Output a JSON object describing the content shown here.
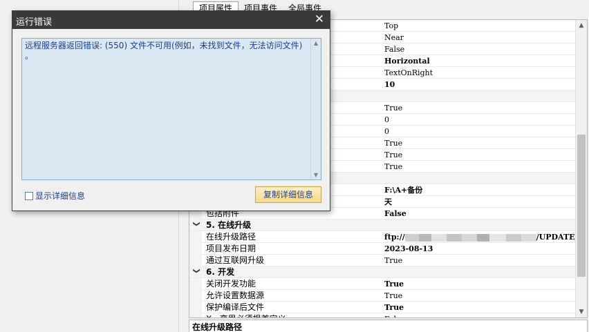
{
  "tabs": [
    "项目属性",
    "项目事件",
    "全局事件"
  ],
  "rows": [
    {
      "type": "prop",
      "name": "",
      "value": "Top",
      "bold": false
    },
    {
      "type": "prop",
      "name": "",
      "value": "Near",
      "bold": false
    },
    {
      "type": "prop",
      "name": "",
      "value": "False",
      "bold": false
    },
    {
      "type": "prop",
      "name": "",
      "value": "Horizontal",
      "bold": true
    },
    {
      "type": "prop",
      "name": "",
      "value": "TextOnRight",
      "bold": false
    },
    {
      "type": "prop",
      "name": "",
      "value": "10",
      "bold": true
    },
    {
      "type": "cat",
      "name": "",
      "value": "",
      "bold": false
    },
    {
      "type": "prop",
      "name": "",
      "value": "True",
      "bold": false
    },
    {
      "type": "prop",
      "name": "",
      "value": "0",
      "bold": false
    },
    {
      "type": "prop",
      "name": "",
      "value": "0",
      "bold": false
    },
    {
      "type": "prop",
      "name": "",
      "value": "True",
      "bold": false
    },
    {
      "type": "prop",
      "name": "",
      "value": "True",
      "bold": false
    },
    {
      "type": "prop",
      "name": "",
      "value": "True",
      "bold": false
    },
    {
      "type": "cat",
      "name": "",
      "value": "",
      "bold": false
    },
    {
      "type": "prop",
      "name": "",
      "value": "F:\\A+备份",
      "bold": true
    },
    {
      "type": "prop",
      "name": "",
      "value": "天",
      "bold": true
    },
    {
      "type": "prop",
      "name": "包括附件",
      "value": "False",
      "bold": true
    },
    {
      "type": "cat",
      "name": "5. 在线升级",
      "value": "",
      "bold": false
    },
    {
      "type": "prop",
      "name": "在线升级路径",
      "value": "ftp://",
      "suffix": "/UPDATE",
      "bold": true,
      "masked": true
    },
    {
      "type": "prop",
      "name": "项目发布日期",
      "value": "2023-08-13",
      "bold": true
    },
    {
      "type": "prop",
      "name": "通过互联网升级",
      "value": "True",
      "bold": false
    },
    {
      "type": "cat",
      "name": "6. 开发",
      "value": "",
      "bold": false
    },
    {
      "type": "prop",
      "name": "关闭开发功能",
      "value": "True",
      "bold": true
    },
    {
      "type": "prop",
      "name": "允许设置数据源",
      "value": "True",
      "bold": false
    },
    {
      "type": "prop",
      "name": "保护编译后文件",
      "value": "True",
      "bold": true
    },
    {
      "type": "prop",
      "name": "X...变里必须根首定义",
      "value": "Fal",
      "bold": false
    }
  ],
  "description_title": "在线升级路径",
  "dialog": {
    "title": "运行错误",
    "close_glyph": "✕",
    "message": "远程服务器返回错误: (550) 文件不可用(例如，未找到文件，无法访问文件)\n。",
    "show_details_label": "显示详细信息",
    "copy_button_label": "复制详细信息"
  }
}
